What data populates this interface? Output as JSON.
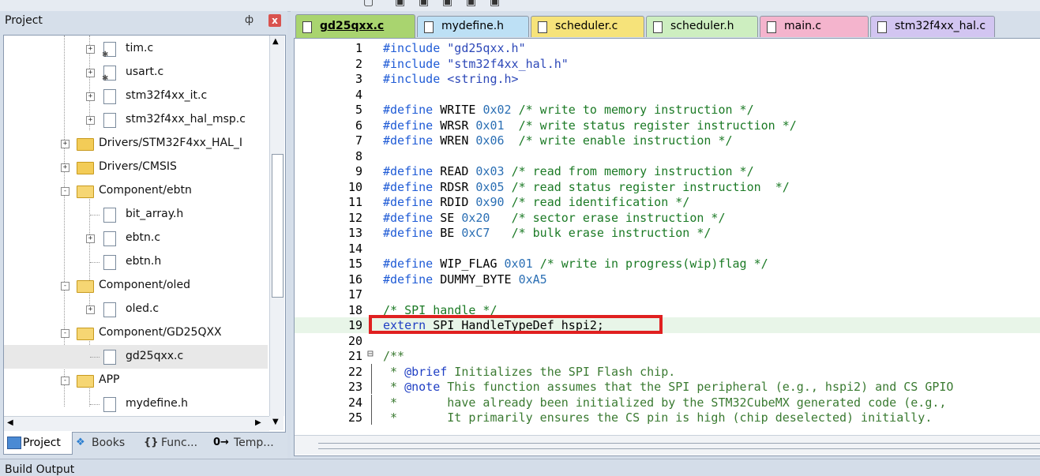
{
  "panel": {
    "title": "Project",
    "pin_glyph": "ф",
    "close_glyph": "x"
  },
  "tree": [
    {
      "label": "tim.c",
      "type": "file-gear",
      "expander": "+"
    },
    {
      "label": "usart.c",
      "type": "file-gear",
      "expander": "+"
    },
    {
      "label": "stm32f4xx_it.c",
      "type": "file",
      "expander": "+"
    },
    {
      "label": "stm32f4xx_hal_msp.c",
      "type": "file",
      "expander": "+"
    },
    {
      "label": "Drivers/STM32F4xx_HAL_I",
      "type": "folder",
      "expander": "+"
    },
    {
      "label": "Drivers/CMSIS",
      "type": "folder",
      "expander": "+"
    },
    {
      "label": "Component/ebtn",
      "type": "folder-open",
      "expander": "-"
    },
    {
      "label": "bit_array.h",
      "type": "file",
      "expander": ""
    },
    {
      "label": "ebtn.c",
      "type": "file",
      "expander": "+"
    },
    {
      "label": "ebtn.h",
      "type": "file",
      "expander": ""
    },
    {
      "label": "Component/oled",
      "type": "folder-open",
      "expander": "-"
    },
    {
      "label": "oled.c",
      "type": "file",
      "expander": "+"
    },
    {
      "label": "Component/GD25QXX",
      "type": "folder-open",
      "expander": "-"
    },
    {
      "label": "gd25qxx.c",
      "type": "file",
      "expander": "",
      "selected": true
    },
    {
      "label": "APP",
      "type": "folder-open",
      "expander": "-"
    },
    {
      "label": "mydefine.h",
      "type": "file",
      "expander": ""
    }
  ],
  "panel_tabs": [
    {
      "label": "Project",
      "icon": "project-icon",
      "active": true
    },
    {
      "label": "Books",
      "icon": "books-icon"
    },
    {
      "label": "Func...",
      "icon": "braces-icon",
      "glyph": "{}"
    },
    {
      "label": "Temp...",
      "icon": "template-icon",
      "glyph": "0→"
    }
  ],
  "editor_tabs": [
    {
      "label": "gd25qxx.c",
      "color": "#a9d46f",
      "active": true
    },
    {
      "label": "mydefine.h",
      "color": "#bde0f5"
    },
    {
      "label": "scheduler.c",
      "color": "#f6e37a"
    },
    {
      "label": "scheduler.h",
      "color": "#cdeec0"
    },
    {
      "label": "main.c",
      "color": "#f4b4cd"
    },
    {
      "label": "stm32f4xx_hal.c",
      "color": "#d2c5f1"
    }
  ],
  "code_lines": [
    {
      "n": "1",
      "text": "#include \"gd25qxx.h\""
    },
    {
      "n": "2",
      "text": "#include \"stm32f4xx_hal.h\""
    },
    {
      "n": "3",
      "text": "#include <string.h>"
    },
    {
      "n": "4",
      "text": ""
    },
    {
      "n": "5",
      "text": "#define WRITE 0x02 /* write to memory instruction */"
    },
    {
      "n": "6",
      "text": "#define WRSR 0x01  /* write status register instruction */"
    },
    {
      "n": "7",
      "text": "#define WREN 0x06  /* write enable instruction */"
    },
    {
      "n": "8",
      "text": ""
    },
    {
      "n": "9",
      "text": "#define READ 0x03 /* read from memory instruction */"
    },
    {
      "n": "10",
      "text": "#define RDSR 0x05 /* read status register instruction  */"
    },
    {
      "n": "11",
      "text": "#define RDID 0x90 /* read identification */"
    },
    {
      "n": "12",
      "text": "#define SE 0x20   /* sector erase instruction */"
    },
    {
      "n": "13",
      "text": "#define BE 0xC7   /* bulk erase instruction */"
    },
    {
      "n": "14",
      "text": ""
    },
    {
      "n": "15",
      "text": "#define WIP_FLAG 0x01 /* write in progress(wip)flag */"
    },
    {
      "n": "16",
      "text": "#define DUMMY_BYTE 0xA5"
    },
    {
      "n": "17",
      "text": ""
    },
    {
      "n": "18",
      "text": "/* SPI handle */"
    },
    {
      "n": "19",
      "text": "extern SPI_HandleTypeDef hspi2;"
    },
    {
      "n": "20",
      "text": ""
    },
    {
      "n": "21",
      "text": "/**"
    },
    {
      "n": "22",
      "text": " * @brief Initializes the SPI Flash chip."
    },
    {
      "n": "23",
      "text": " * @note This function assumes that the SPI peripheral (e.g., hspi2) and CS GPIO"
    },
    {
      "n": "24",
      "text": " *       have already been initialized by the STM32CubeMX generated code (e.g.,"
    },
    {
      "n": "25",
      "text": " *       It primarily ensures the CS pin is high (chip deselected) initially."
    }
  ],
  "build_output": {
    "label": "Build Output"
  }
}
